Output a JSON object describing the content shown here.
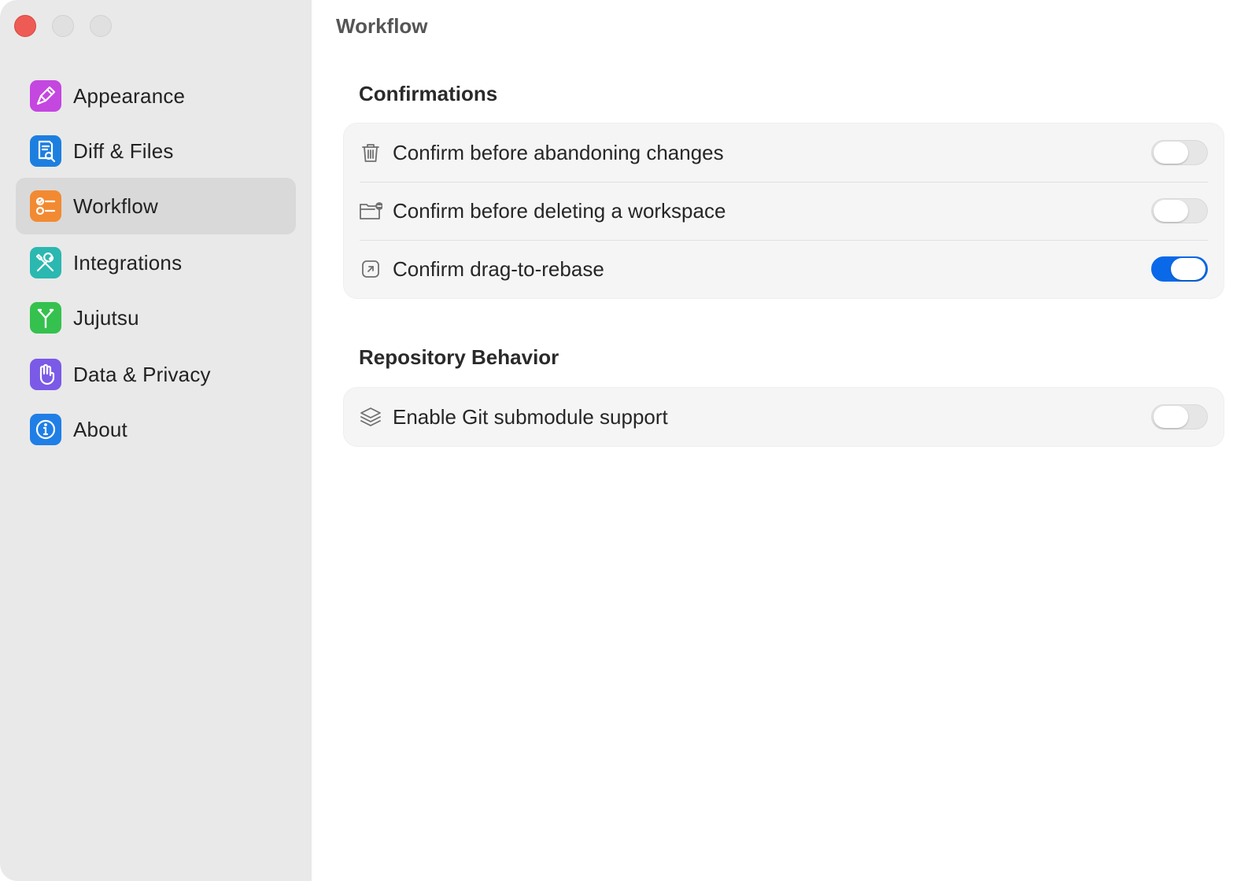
{
  "window": {
    "title": "Workflow"
  },
  "sidebar": {
    "items": [
      {
        "label": "Appearance",
        "icon": "paintbrush-icon",
        "color": "#c447e0",
        "selected": false
      },
      {
        "label": "Diff & Files",
        "icon": "document-search-icon",
        "color": "#1c7fe0",
        "selected": false
      },
      {
        "label": "Workflow",
        "icon": "checklist-icon",
        "color": "#f28a32",
        "selected": true
      },
      {
        "label": "Integrations",
        "icon": "tools-icon",
        "color": "#2ab8b0",
        "selected": false
      },
      {
        "label": "Jujutsu",
        "icon": "branch-icon",
        "color": "#35c14e",
        "selected": false
      },
      {
        "label": "Data & Privacy",
        "icon": "hand-icon",
        "color": "#7a5ae6",
        "selected": false
      },
      {
        "label": "About",
        "icon": "info-icon",
        "color": "#1f7fe6",
        "selected": false
      }
    ]
  },
  "main": {
    "sections": [
      {
        "title": "Confirmations",
        "rows": [
          {
            "label": "Confirm before abandoning changes",
            "icon": "trash-icon",
            "enabled": false
          },
          {
            "label": "Confirm before deleting a workspace",
            "icon": "folder-remove-icon",
            "enabled": false
          },
          {
            "label": "Confirm drag-to-rebase",
            "icon": "arrow-square-icon",
            "enabled": true
          }
        ]
      },
      {
        "title": "Repository Behavior",
        "rows": [
          {
            "label": "Enable Git submodule support",
            "icon": "layers-icon",
            "enabled": false
          }
        ]
      }
    ]
  },
  "colors": {
    "accent": "#0a69e8",
    "sidebar_bg": "#e9e9e9",
    "close_button": "#ee5b55"
  }
}
